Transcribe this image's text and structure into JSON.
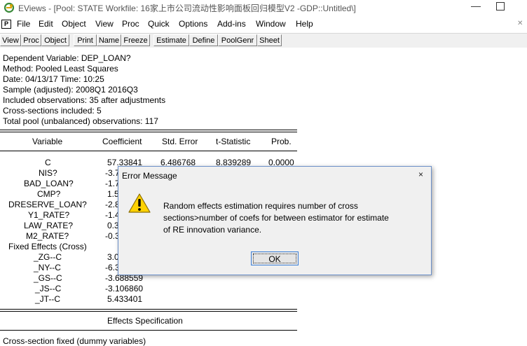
{
  "window": {
    "title": "EViews - [Pool: STATE    Workfile: 16家上市公司流动性影响面板回归模型V2 -GDP::Untitled\\]"
  },
  "menu": {
    "p_icon": "P",
    "items": [
      "File",
      "Edit",
      "Object",
      "View",
      "Proc",
      "Quick",
      "Options",
      "Add-ins",
      "Window",
      "Help"
    ]
  },
  "toolbar": {
    "buttons": [
      "View",
      "Proc",
      "Object",
      "Print",
      "Name",
      "Freeze",
      "Estimate",
      "Define",
      "PoolGenr",
      "Sheet"
    ]
  },
  "output": {
    "header_lines": [
      "Dependent Variable: DEP_LOAN?",
      "Method: Pooled Least Squares",
      "Date: 04/13/17   Time: 10:25",
      "Sample (adjusted): 2008Q1 2016Q3",
      "Included observations: 35 after adjustments",
      "Cross-sections included: 5",
      "Total pool (unbalanced) observations: 117"
    ],
    "columns": [
      "Variable",
      "Coefficient",
      "Std. Error",
      "t-Statistic",
      "Prob."
    ],
    "rows": [
      {
        "variable": "C",
        "coefficient": "57.33841",
        "std_error": "6.486768",
        "t_stat": "8.839289",
        "prob": "0.0000"
      },
      {
        "variable": "NIS?",
        "coefficient": "-3.7",
        "std_error": "",
        "t_stat": "",
        "prob": ""
      },
      {
        "variable": "BAD_LOAN?",
        "coefficient": "-1.7",
        "std_error": "",
        "t_stat": "",
        "prob": ""
      },
      {
        "variable": "CMP?",
        "coefficient": "1.5",
        "std_error": "",
        "t_stat": "",
        "prob": ""
      },
      {
        "variable": "DRESERVE_LOAN?",
        "coefficient": "-2.8",
        "std_error": "",
        "t_stat": "",
        "prob": ""
      },
      {
        "variable": "Y1_RATE?",
        "coefficient": "-1.4",
        "std_error": "",
        "t_stat": "",
        "prob": ""
      },
      {
        "variable": "LAW_RATE?",
        "coefficient": "0.3",
        "std_error": "",
        "t_stat": "",
        "prob": ""
      },
      {
        "variable": "M2_RATE?",
        "coefficient": "-0.3",
        "std_error": "",
        "t_stat": "",
        "prob": ""
      }
    ],
    "fixed_effects_label": "Fixed Effects (Cross)",
    "fixed_effects": [
      {
        "variable": "_ZG--C",
        "coefficient": "3.0"
      },
      {
        "variable": "_NY--C",
        "coefficient": "-6.3"
      },
      {
        "variable": "_GS--C",
        "coefficient": "-3.688559"
      },
      {
        "variable": "_JS--C",
        "coefficient": "-3.106860"
      },
      {
        "variable": "_JT--C",
        "coefficient": "5.433401"
      }
    ],
    "effects_spec_label": "Effects Specification",
    "cross_section_line": "Cross-section fixed (dummy variables)"
  },
  "dialog": {
    "title": "Error Message",
    "close_glyph": "×",
    "message_lines": [
      "Random effects estimation requires number of cross",
      " sections>number of coefs for between estimator for estimate",
      "of RE innovation variance."
    ],
    "ok_label": "OK"
  }
}
